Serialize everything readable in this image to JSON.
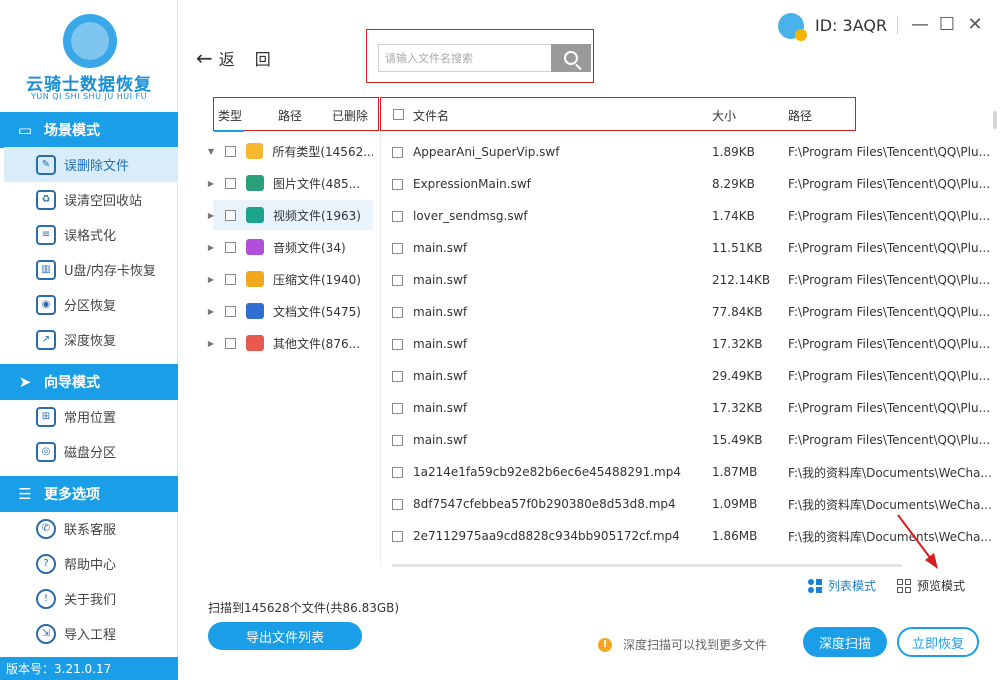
{
  "sidebar": {
    "logo_title": "云骑士数据恢复",
    "logo_sub": "YUN QI SHI SHU JU HUI FU",
    "sections": [
      {
        "label": "场景模式",
        "icon": "monitor-icon"
      },
      {
        "label": "向导模式",
        "icon": "signpost-icon"
      },
      {
        "label": "更多选项",
        "icon": "menu-icon"
      }
    ],
    "items": [
      {
        "label": "误删除文件",
        "icon": "delete-file-icon"
      },
      {
        "label": "误清空回收站",
        "icon": "recycle-bin-icon"
      },
      {
        "label": "误格式化",
        "icon": "format-icon"
      },
      {
        "label": "U盘/内存卡恢复",
        "icon": "usb-icon"
      },
      {
        "label": "分区恢复",
        "icon": "partition-icon"
      },
      {
        "label": "深度恢复",
        "icon": "deep-recovery-icon"
      },
      {
        "label": "常用位置",
        "icon": "windows-icon"
      },
      {
        "label": "磁盘分区",
        "icon": "disk-icon"
      },
      {
        "label": "联系客服",
        "icon": "phone-icon"
      },
      {
        "label": "帮助中心",
        "icon": "help-icon"
      },
      {
        "label": "关于我们",
        "icon": "info-icon"
      },
      {
        "label": "导入工程",
        "icon": "import-icon"
      }
    ],
    "version": "版本号：3.21.0.17"
  },
  "titlebar": {
    "id_text": "ID: 3AQR",
    "minimize": "—",
    "maximize": "☐",
    "close": "✕"
  },
  "toolbar": {
    "back_label": "返",
    "back_label2": "回",
    "search_placeholder": "请输入文件名搜索"
  },
  "tree_tabs": [
    "类型",
    "路径",
    "已删除"
  ],
  "columns": {
    "name": "文件名",
    "size": "大小",
    "path": "路径"
  },
  "tree": [
    {
      "label": "所有类型(14562...",
      "expanded": true,
      "color": "#f5b82e"
    },
    {
      "label": "图片文件(485...",
      "expanded": false,
      "color": "#2aa07a"
    },
    {
      "label": "视频文件(1963)",
      "expanded": false,
      "color": "#1ba38b"
    },
    {
      "label": "音频文件(34)",
      "expanded": false,
      "color": "#b24fd8"
    },
    {
      "label": "压缩文件(1940)",
      "expanded": false,
      "color": "#f2a81d"
    },
    {
      "label": "文档文件(5475)",
      "expanded": false,
      "color": "#2f6fd1"
    },
    {
      "label": "其他文件(876...",
      "expanded": false,
      "color": "#e85a4f"
    }
  ],
  "files": [
    {
      "name": "AppearAni_SuperVip.swf",
      "size": "1.89KB",
      "path": "F:\\Program Files\\Tencent\\QQ\\Plu..."
    },
    {
      "name": "ExpressionMain.swf",
      "size": "8.29KB",
      "path": "F:\\Program Files\\Tencent\\QQ\\Plu..."
    },
    {
      "name": "lover_sendmsg.swf",
      "size": "1.74KB",
      "path": "F:\\Program Files\\Tencent\\QQ\\Plu..."
    },
    {
      "name": "main.swf",
      "size": "11.51KB",
      "path": "F:\\Program Files\\Tencent\\QQ\\Plu..."
    },
    {
      "name": "main.swf",
      "size": "212.14KB",
      "path": "F:\\Program Files\\Tencent\\QQ\\Plu..."
    },
    {
      "name": "main.swf",
      "size": "77.84KB",
      "path": "F:\\Program Files\\Tencent\\QQ\\Plu..."
    },
    {
      "name": "main.swf",
      "size": "17.32KB",
      "path": "F:\\Program Files\\Tencent\\QQ\\Plu..."
    },
    {
      "name": "main.swf",
      "size": "29.49KB",
      "path": "F:\\Program Files\\Tencent\\QQ\\Plu..."
    },
    {
      "name": "main.swf",
      "size": "17.32KB",
      "path": "F:\\Program Files\\Tencent\\QQ\\Plu..."
    },
    {
      "name": "main.swf",
      "size": "15.49KB",
      "path": "F:\\Program Files\\Tencent\\QQ\\Plu..."
    },
    {
      "name": "1a214e1fa59cb92e82b6ec6e45488291.mp4",
      "size": "1.87MB",
      "path": "F:\\我的资料库\\Documents\\WeCha..."
    },
    {
      "name": "8df7547cfebbea57f0b290380e8d53d8.mp4",
      "size": "1.09MB",
      "path": "F:\\我的资料库\\Documents\\WeCha..."
    },
    {
      "name": "2e7112975aa9cd8828c934bb905172cf.mp4",
      "size": "1.86MB",
      "path": "F:\\我的资料库\\Documents\\WeCha..."
    }
  ],
  "view_modes": {
    "list": "列表模式",
    "preview": "预览模式",
    "active_color": "#1b7fd0"
  },
  "footer": {
    "scan_count": "扫描到145628个文件(共86.83GB)",
    "export_button": "导出文件列表",
    "hint": "深度扫描可以找到更多文件",
    "deep_scan_button": "深度扫描",
    "recover_button": "立即恢复"
  },
  "colors": {
    "accent": "#1b9ee8",
    "highlight_border": "#d62020"
  }
}
